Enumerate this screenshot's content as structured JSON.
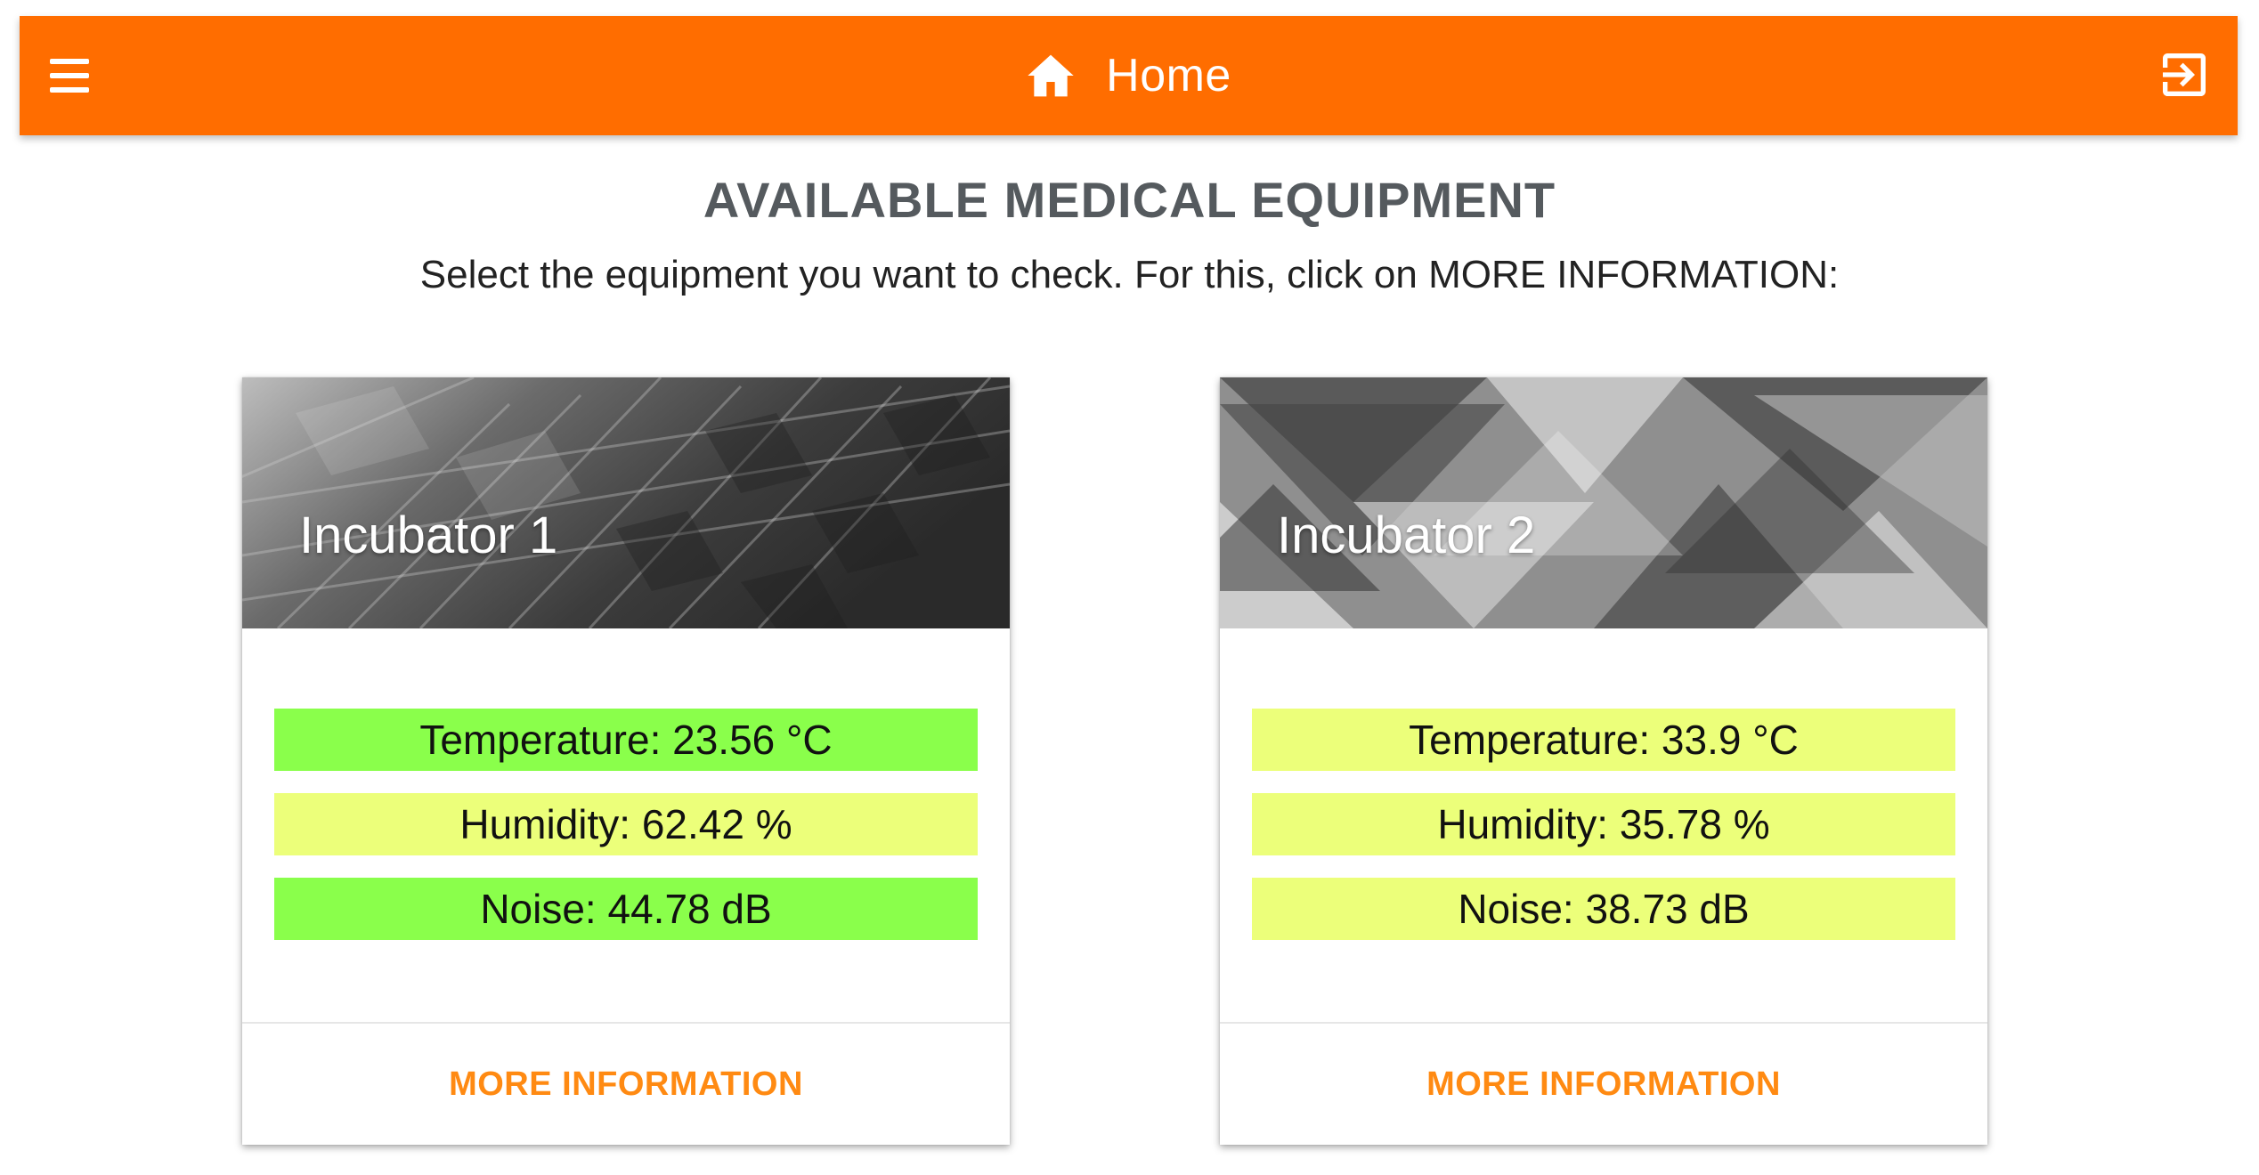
{
  "header": {
    "title": "Home",
    "menu_icon": "menu-icon",
    "home_icon": "home-icon",
    "logout_icon": "logout-icon",
    "background_color": "#ff6d00"
  },
  "main": {
    "heading": "AVAILABLE MEDICAL EQUIPMENT",
    "subtitle": "Select the equipment you want to check. For this, click on MORE INFORMATION:"
  },
  "cards": [
    {
      "title": "Incubator 1",
      "readings": [
        {
          "text": "Temperature: 23.56 °C",
          "color": "#8aff4b"
        },
        {
          "text": "Humidity: 62.42 %",
          "color": "#ecff7a"
        },
        {
          "text": "Noise: 44.78 dB",
          "color": "#8aff4b"
        }
      ],
      "action_label": "MORE INFORMATION"
    },
    {
      "title": "Incubator 2",
      "readings": [
        {
          "text": "Temperature: 33.9 °C",
          "color": "#ecff7a"
        },
        {
          "text": "Humidity: 35.78 %",
          "color": "#ecff7a"
        },
        {
          "text": "Noise: 38.73 dB",
          "color": "#ecff7a"
        }
      ],
      "action_label": "MORE INFORMATION"
    }
  ],
  "colors": {
    "accent": "#ff6d00",
    "action_text": "#ff8a12",
    "status_ok": "#8aff4b",
    "status_warn": "#ecff7a"
  }
}
